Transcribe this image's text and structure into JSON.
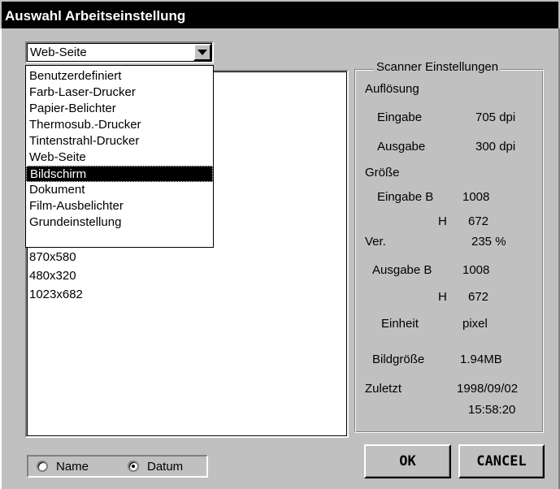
{
  "window": {
    "title": "Auswahl Arbeitseinstellung"
  },
  "combo": {
    "value": "Web-Seite"
  },
  "dropdown": {
    "options": [
      "Benutzerdefiniert",
      "Farb-Laser-Drucker",
      "Papier-Belichter",
      "Thermosub.-Drucker",
      "Tintenstrahl-Drucker",
      "Web-Seite",
      "Bildschirm",
      "Dokument",
      "Film-Ausbelichter",
      "Grundeinstellung"
    ],
    "selected": "Bildschirm"
  },
  "list": {
    "items": [
      "870x580",
      "480x320",
      "1023x682"
    ]
  },
  "scanner": {
    "title": "Scanner Einstellungen",
    "aufloesung": "Auflösung",
    "eingabe_label": "Eingabe",
    "eingabe_value": "705 dpi",
    "ausgabe_label": "Ausgabe",
    "ausgabe_value": "300 dpi",
    "groesse": "Größe",
    "eingabe_b_label": "Eingabe B",
    "eingabe_b_value": "1008",
    "eingabe_h_label": "H",
    "eingabe_h_value": "672",
    "ver_label": "Ver.",
    "ver_value": "235 %",
    "ausgabe_b_label": "Ausgabe B",
    "ausgabe_b_value": "1008",
    "ausgabe_h_label": "H",
    "ausgabe_h_value": "672",
    "einheit_label": "Einheit",
    "einheit_value": "pixel",
    "bildgroesse_label": "Bildgröße",
    "bildgroesse_value": "1.94MB",
    "zuletzt_label": "Zuletzt",
    "zuletzt_date": "1998/09/02",
    "zuletzt_time": "15:58:20"
  },
  "sort": {
    "name_label": "Name",
    "datum_label": "Datum",
    "selected": "Datum"
  },
  "buttons": {
    "ok": "OK",
    "cancel": "CANCEL"
  }
}
